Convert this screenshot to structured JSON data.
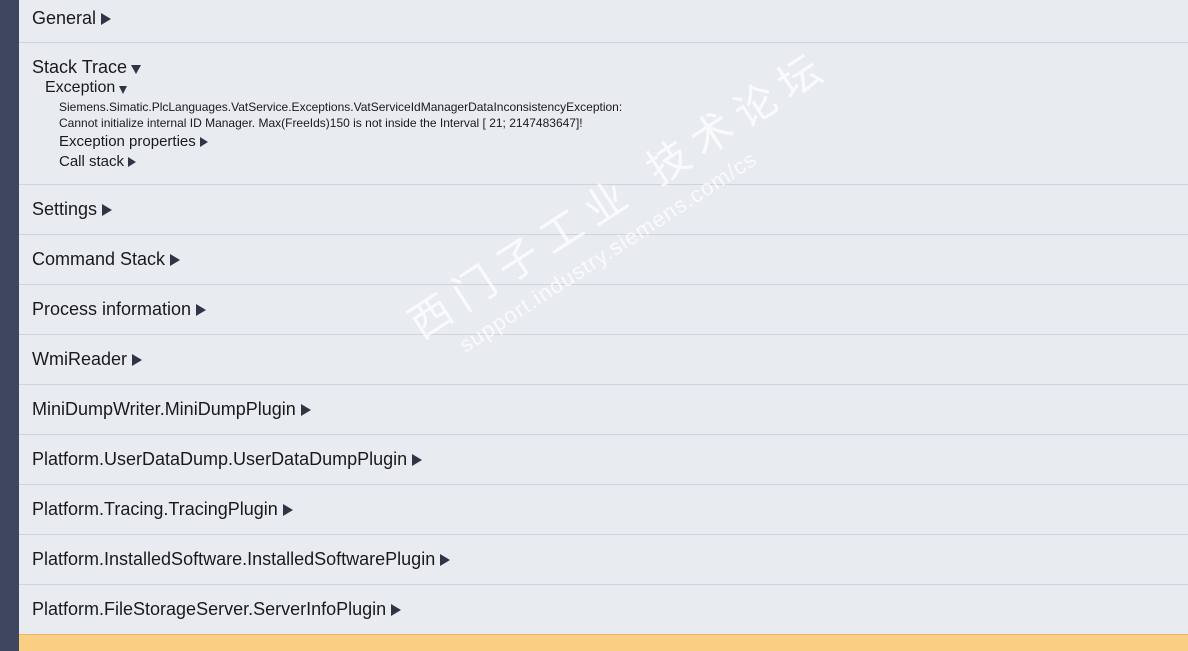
{
  "sections": {
    "general": "General",
    "stack_trace": {
      "title": "Stack Trace",
      "exception": {
        "title": "Exception",
        "line1": "Siemens.Simatic.PlcLanguages.VatService.Exceptions.VatServiceIdManagerDataInconsistencyException:",
        "line2": "Cannot initialize internal ID Manager. Max(FreeIds)150 is not inside the Interval [ 21; 2147483647]!",
        "properties": "Exception properties",
        "call_stack": "Call stack"
      }
    },
    "settings": "Settings",
    "command_stack": "Command Stack",
    "process_information": "Process information",
    "wmi_reader": "WmiReader",
    "minidump_writer": "MiniDumpWriter.MiniDumpPlugin",
    "user_data_dump": "Platform.UserDataDump.UserDataDumpPlugin",
    "tracing": "Platform.Tracing.TracingPlugin",
    "installed_software": "Platform.InstalledSoftware.InstalledSoftwarePlugin",
    "file_storage_server": "Platform.FileStorageServer.ServerInfoPlugin"
  },
  "watermark": {
    "chinese": "西门子工业 技术论坛",
    "url": "support.industry.siemens.com/cs"
  },
  "colors": {
    "sidebar": "#3e4660",
    "background": "#e8ebf0",
    "bottom_band": "#fbcf83"
  },
  "icons": {
    "collapsed": "triangle-right-icon",
    "expanded": "triangle-down-icon"
  }
}
